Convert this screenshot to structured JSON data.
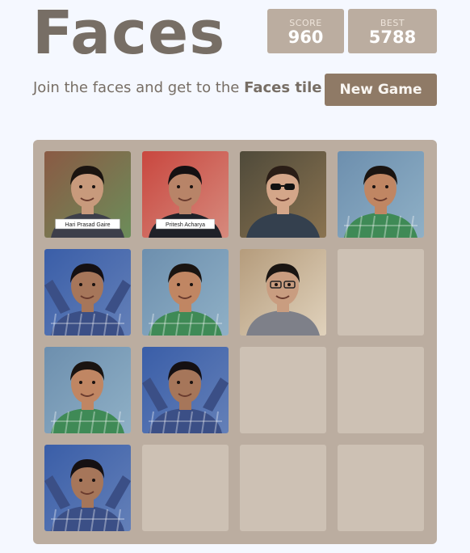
{
  "header": {
    "title": "Faces",
    "score_label": "SCORE",
    "score_value": "960",
    "best_label": "BEST",
    "best_value": "5788"
  },
  "intro": {
    "text_before": "Join the faces and get to the ",
    "text_bold": "Faces tile"
  },
  "new_game_label": "New Game",
  "colors": {
    "background": "#f5f8ff",
    "board": "#bbada0",
    "empty_cell": "#cdc1b4",
    "button": "#8f7a66",
    "title_text": "#776e65"
  },
  "tiles": [
    [
      {
        "face": "face-suit",
        "caption": "Hari Prasad Gaire"
      },
      {
        "face": "face-suit-red",
        "caption": "Pritesh Acharya"
      },
      {
        "face": "face-sunglasses",
        "caption": ""
      },
      {
        "face": "face-smile-green",
        "caption": ""
      }
    ],
    [
      {
        "face": "face-plaid-arms",
        "caption": ""
      },
      {
        "face": "face-smile-green",
        "caption": ""
      },
      {
        "face": "face-glasses-grey",
        "caption": ""
      },
      null
    ],
    [
      {
        "face": "face-smile-green",
        "caption": ""
      },
      {
        "face": "face-plaid-arms",
        "caption": ""
      },
      null,
      null
    ],
    [
      {
        "face": "face-plaid-arms",
        "caption": ""
      },
      null,
      null,
      null
    ]
  ]
}
